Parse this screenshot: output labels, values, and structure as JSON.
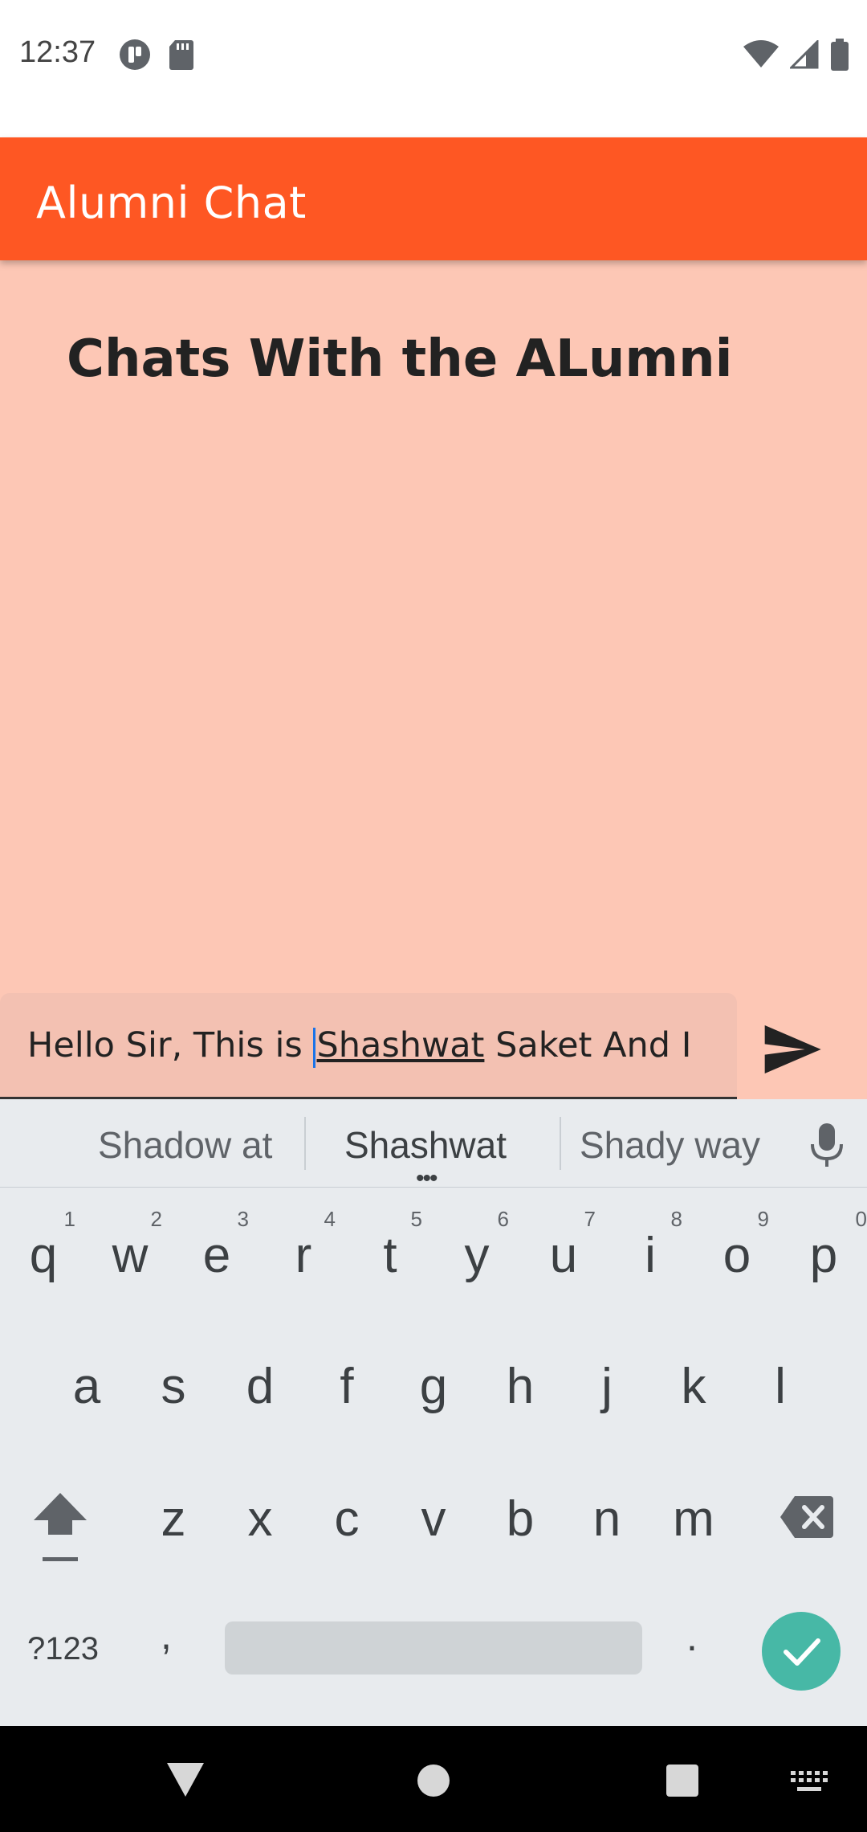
{
  "status_bar": {
    "time": "12:37",
    "left_icons": [
      "notification-app-icon",
      "sd-card-icon"
    ],
    "right_icons": [
      "wifi-icon",
      "signal-icon",
      "battery-icon"
    ]
  },
  "app_bar": {
    "title": "Alumni Chat",
    "color": "#fe5723"
  },
  "content": {
    "heading": "Chats With the ALumni",
    "background": "#fdc7b5"
  },
  "composer": {
    "text_before": "Hello Sir, This is ",
    "text_underlined": "Shashwat",
    "text_after": " Saket And  I",
    "send_icon": "send-icon"
  },
  "keyboard": {
    "suggestions": [
      "Shadow at",
      "Shashwat",
      "Shady way"
    ],
    "row1": [
      {
        "k": "q",
        "h": "1"
      },
      {
        "k": "w",
        "h": "2"
      },
      {
        "k": "e",
        "h": "3"
      },
      {
        "k": "r",
        "h": "4"
      },
      {
        "k": "t",
        "h": "5"
      },
      {
        "k": "y",
        "h": "6"
      },
      {
        "k": "u",
        "h": "7"
      },
      {
        "k": "i",
        "h": "8"
      },
      {
        "k": "o",
        "h": "9"
      },
      {
        "k": "p",
        "h": "0"
      }
    ],
    "row2": [
      "a",
      "s",
      "d",
      "f",
      "g",
      "h",
      "j",
      "k",
      "l"
    ],
    "row3": [
      "z",
      "x",
      "c",
      "v",
      "b",
      "n",
      "m"
    ],
    "sym_label": "?123",
    "comma": ",",
    "period": ".",
    "enter_color": "#47b8a6"
  }
}
